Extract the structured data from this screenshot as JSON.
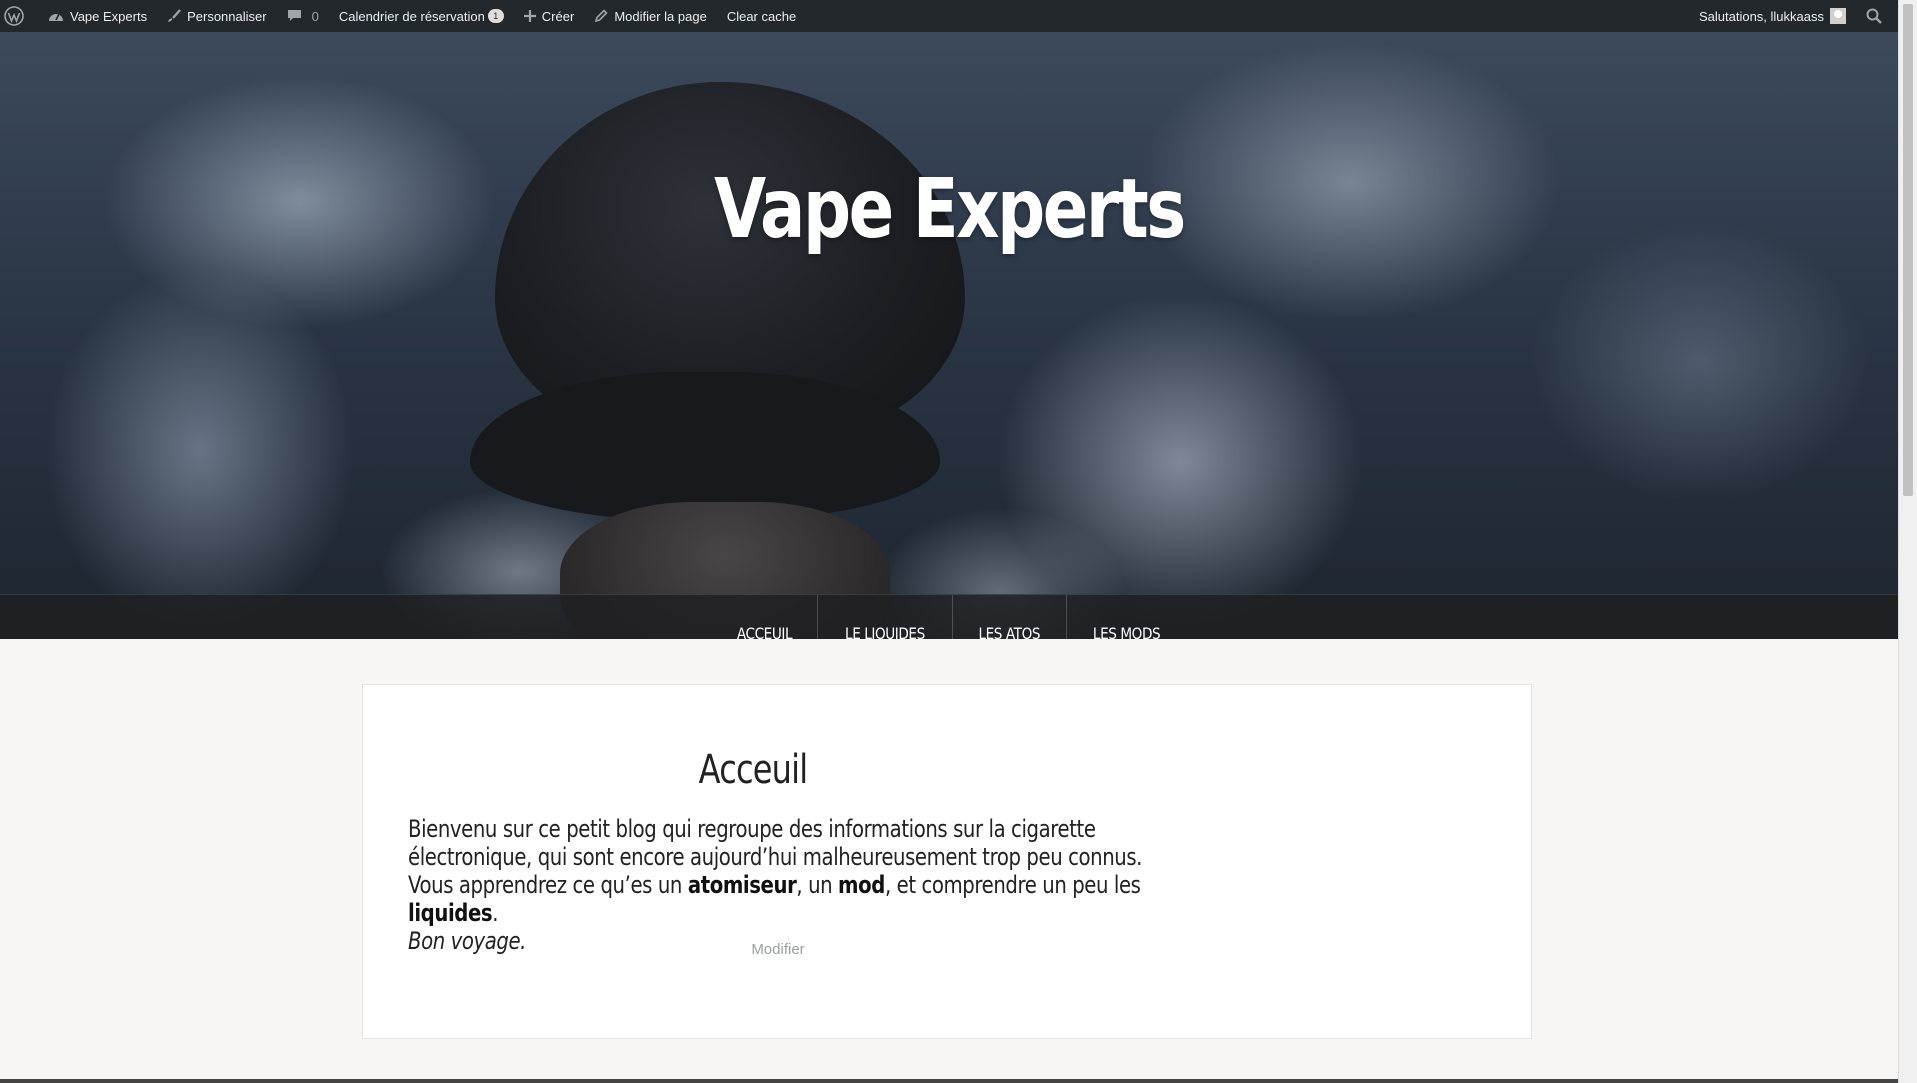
{
  "adminbar": {
    "site_name": "Vape Experts",
    "customize": "Personnaliser",
    "comments_count": "0",
    "calendar": "Calendrier de réservation",
    "calendar_badge": "1",
    "new": "Créer",
    "edit_page": "Modifier la page",
    "clear_cache": "Clear cache",
    "greeting": "Salutations, llukkaass"
  },
  "hero": {
    "site_title": "Vape Experts"
  },
  "nav": {
    "items": [
      {
        "label": "ACCEUIL"
      },
      {
        "label": "LE LIQUIDES"
      },
      {
        "label": "LES ATOS"
      },
      {
        "label": "LES MODS"
      }
    ]
  },
  "entry": {
    "title": "Acceuil",
    "text_1": "Bienvenu sur ce petit blog qui regroupe des informations sur la cigarette électronique, qui sont encore aujourd’hui malheureusement trop peu connus. Vous apprendrez ce qu’es un ",
    "bold_1": "atomiseur",
    "text_2": ", un ",
    "bold_2": "mod",
    "text_3": ", et comprendre un peu les ",
    "bold_3": "liquides",
    "text_4": ".",
    "italic": "Bon voyage.",
    "edit_link": "Modifier"
  }
}
